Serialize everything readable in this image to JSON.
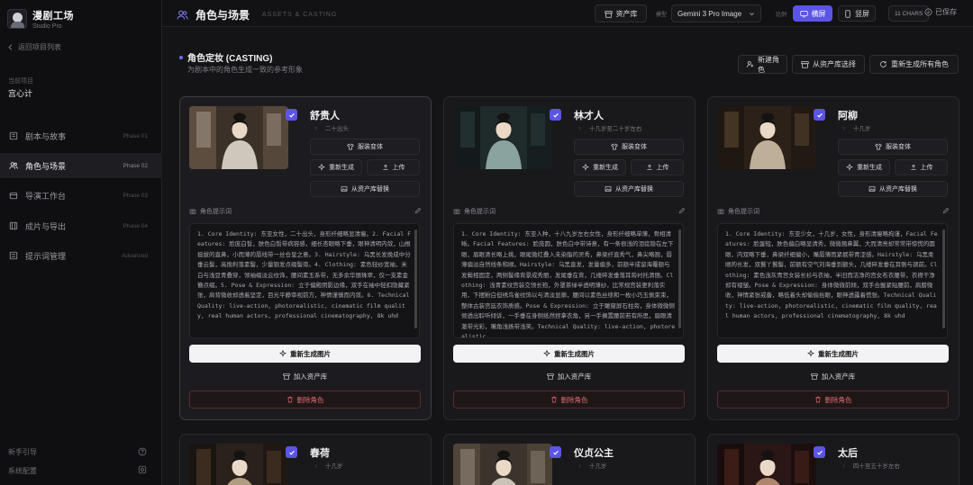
{
  "app": {
    "title": "漫剧工场",
    "subtitle": "Studio Pro"
  },
  "sidebar": {
    "back_label": "返回项目列表",
    "project_label": "当前项目",
    "project_name": "宫心计",
    "items": [
      {
        "label": "剧本与故事",
        "phase": "Phase 01",
        "icon": "book-icon",
        "active": false
      },
      {
        "label": "角色与场景",
        "phase": "Phase 02",
        "icon": "users-icon",
        "active": true
      },
      {
        "label": "导演工作台",
        "phase": "Phase 03",
        "icon": "clapper-icon",
        "active": false
      },
      {
        "label": "成片与导出",
        "phase": "Phase 04",
        "icon": "film-icon",
        "active": false
      },
      {
        "label": "提示词管理",
        "phase": "Advanced",
        "icon": "list-icon",
        "active": false
      }
    ],
    "bottom": [
      {
        "label": "新手引导",
        "icon": "help-circle-icon"
      },
      {
        "label": "系统配置",
        "icon": "settings-icon"
      }
    ]
  },
  "topbar": {
    "title": "角色与场景",
    "title_en": "ASSETS & CASTING",
    "asset_lib_label": "资产库",
    "model_label": "模型",
    "model_value": "Gemini 3 Pro Image",
    "ratio_label": "比例",
    "landscape_label": "横屏",
    "portrait_label": "竖屏",
    "chars_label": "11 CHARS",
    "saved_label": "已保存"
  },
  "section": {
    "title": "角色定妆 (CASTING)",
    "subtitle": "为剧本中的角色生成一致的参考形象",
    "new_role_label": "新建角色",
    "from_lib_label": "从资产库选择",
    "regen_all_label": "重新生成所有角色"
  },
  "labels": {
    "costume": "服装变体",
    "regen": "重新生成",
    "upload": "上传",
    "replace": "从资产库替换",
    "prompt_header": "角色提示词",
    "regen_image": "重新生成图片",
    "add_lib": "加入资产库",
    "delete": "删除角色"
  },
  "characters": [
    {
      "name": "舒贵人",
      "age": "二十出头",
      "selected": true,
      "theme": "light",
      "prompt": "1. Core Identity: 东亚女性，二十出头，身形纤细略显清瘦。2. Facial Features: 脸庞白皙，肤色白皙带病容感，细长杏眼略下垂，眼神清明内敛，山根挺拔的直鼻，小而薄的唇线带一丝仓皇之意。3. Hairstyle: 乌黑长发挽成中分垂云髻，高挽利落素髻，少量银发点缀髻旁。4. Clothing: 素色轻纱宽袖，米白与浅豆青叠穿，领袖缀淡云纹饰，腰间素玉系带，无多余华丽珠翠，仅一支素金簪点缀。5. Pose & Expression: 立于偏殿阴影边缘，双手在袖中轻扣隐藏紧张，肩背微收却透着坚定，目光平静审视前方，神情谨慎而内敛。6. Technical Quality: live-action, photorealistic, cinematic film quality, real human actors, professional cinematography, 8k uhd"
    },
    {
      "name": "林才人",
      "age": "十几岁至二十岁左右",
      "selected": true,
      "theme": "teal",
      "prompt": "1. Core Identity: 东亚人种，十八九岁左右女性，身形纤细略单薄，骨相清晰。Facial Features: 脸庞圆，肤色白中带诗意，有一条很浅的泪痣隐在左下眼，眉眼清长略上挑，眼尾微红叠入未染脂的灵秀，鼻梁纤直秀气，鼻尖略翘，唇薄偏淡自然线条和顺。Hairstyle: 乌黑直发，发量偏多，前额半成留海覆额与发鬓相固定，两侧髻缘背景成秀丽，发尾垂在背，几缕碎发垂落耳旁衬托清丽。Clothing: 浅青素纹宫装交领长袍，外罩茶绿半透明薄纱，比常规宫装更利落实用，下摆粉白但绣鸟雀纹饰以与清淡显廓，腰间以素色丝绦和一枚小巧玉佩束束，整体古装宫廷衣饰质感。Pose & Expression: 立于雕窗屏石柱旁，身体微微侧倾透出聆听倾诉，一手垂在身侧纸然捏拿衣角，另一手搁置腰前若有所思，眉眼清澈带光彩，嘴角浅扬带浅笑。Technical Quality: live-action, photorealistic"
    },
    {
      "name": "阿柳",
      "age": "十几岁",
      "selected": true,
      "theme": "warm",
      "prompt": "1. Core Identity: 东亚少女，十几岁，女性，身形清瘦略拘谨，Facial Features: 脸蛋短，肤色偏白略显清秀，微微翘鼻翼，大而清亮却常常带惊慌的圆眼，内双略下垂，鼻梁纤细偏小，嘴唇薄而紧抿带青涩感。Hairstyle: 乌黑柔顺的长发，双鬟丫鬟髻，前额有空气刘海垂到额头，几缕碎发垂在耳侧与颈前。Clothing: 素色浅灰青宫女装长衫与衣袖，半旧而洁净的宫女布衣腰带，衣襟干净却有褶皱。Pose & Expression: 身体微微前倾，双手合握紧贴腰前，肩膀微收，神情紧张戒备，略低着头却偷偷抬眼，眼神透露着慌张。Technical Quality: live-action, photorealistic, cinematic film quality, real human actors, professional cinematography, 8k uhd"
    },
    {
      "name": "春荷",
      "age": "十几岁",
      "selected": true,
      "theme": "warm2",
      "prompt": ""
    },
    {
      "name": "仪贞公主",
      "age": "十几岁",
      "selected": true,
      "theme": "light2",
      "prompt": ""
    },
    {
      "name": "太后",
      "age": "四十至五十岁左右",
      "selected": true,
      "theme": "red",
      "prompt": ""
    }
  ]
}
